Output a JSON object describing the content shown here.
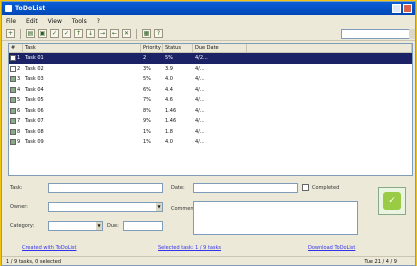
{
  "window": {
    "title": "ToDoList"
  },
  "menubar": {
    "items": [
      "File",
      "Edit",
      "View",
      "Tools",
      "?"
    ]
  },
  "toolbar": {
    "search_value": ""
  },
  "list": {
    "columns": [
      "#",
      "Task",
      "Priority",
      "Status",
      "Due Date"
    ],
    "rows": [
      {
        "num": "1",
        "name": "Task 01",
        "prio": "2",
        "status": "5%",
        "date": "4/2...",
        "checked": false,
        "selected": true
      },
      {
        "num": "2",
        "name": "Task 02",
        "prio": "3%",
        "status": "3.9",
        "date": "4/...",
        "checked": false,
        "selected": false
      },
      {
        "num": "3",
        "name": "Task 03",
        "prio": "5%",
        "status": "4.0",
        "date": "4/...",
        "checked": true,
        "selected": false
      },
      {
        "num": "4",
        "name": "Task 04",
        "prio": "6%",
        "status": "4.4",
        "date": "4/...",
        "checked": true,
        "selected": false
      },
      {
        "num": "5",
        "name": "Task 05",
        "prio": "7%",
        "status": "4.6",
        "date": "4/...",
        "checked": true,
        "selected": false
      },
      {
        "num": "6",
        "name": "Task 06",
        "prio": "8%",
        "status": "1.46",
        "date": "4/...",
        "checked": true,
        "selected": false
      },
      {
        "num": "7",
        "name": "Task 07",
        "prio": "9%",
        "status": "1.46",
        "date": "4/...",
        "checked": true,
        "selected": false
      },
      {
        "num": "8",
        "name": "Task 08",
        "prio": "1%",
        "status": "1.8",
        "date": "4/...",
        "checked": true,
        "selected": false
      },
      {
        "num": "9",
        "name": "Task 09",
        "prio": "1%",
        "status": "4.0",
        "date": "4/...",
        "checked": true,
        "selected": false
      }
    ]
  },
  "form": {
    "label_task": "Task:",
    "label_owner": "Owner:",
    "label_category": "Category:",
    "label_due": "Due:",
    "label_date": "Date:",
    "label_comment": "Comment:",
    "completed_label": "Completed",
    "task_value": "",
    "owner_value": "",
    "category_value": "",
    "due_value": "",
    "date_value": ""
  },
  "links": {
    "left": "Created with ToDoList",
    "mid": "Selected task: 1 / 9 tasks",
    "right": "Download ToDoList"
  },
  "statusbar": {
    "left": "1 / 9 tasks, 0 selected",
    "right": "Tue 21 / 4 / 9"
  },
  "colors": {
    "selection": "#1b2366",
    "titlebar": "#0a5fd6",
    "background": "#f1c40f"
  }
}
